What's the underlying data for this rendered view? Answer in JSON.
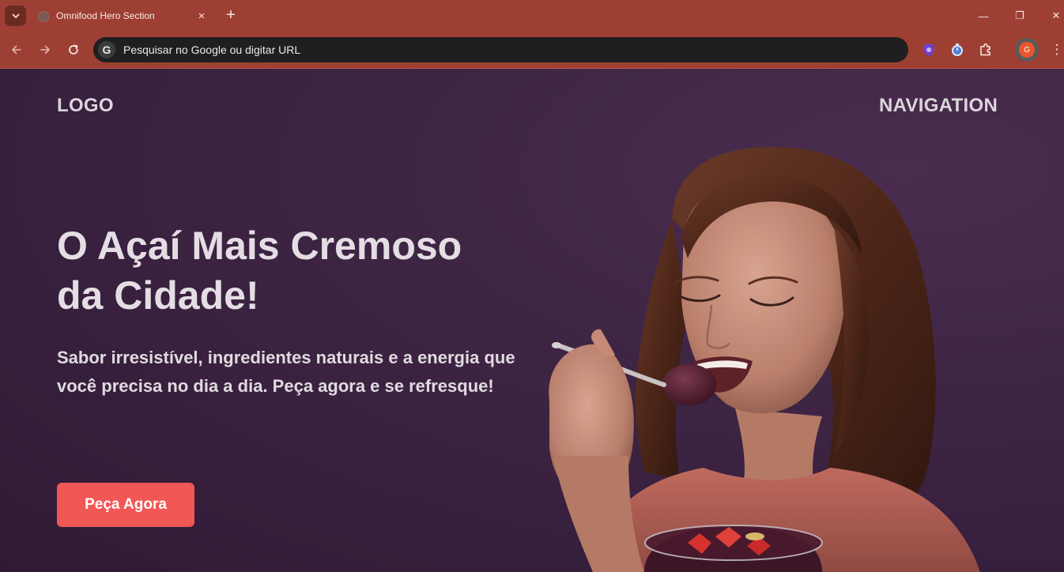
{
  "browser": {
    "tab_title": "Omnifood Hero Section",
    "tab_close": "×",
    "new_tab": "+",
    "omnibox_placeholder": "Pesquisar no Google ou digitar URL",
    "profile_initial": "G",
    "window": {
      "minimize": "—",
      "restore": "❐",
      "close": "✕"
    }
  },
  "hero": {
    "logo": "LOGO",
    "navigation": "NAVIGATION",
    "headline_line1": "O Açaí Mais Cremoso",
    "headline_line2": "da Cidade!",
    "subtext": "Sabor irresistível, ingredientes naturais e a energia que você precisa no dia a dia. Peça agora e se refresque!",
    "cta_label": "Peça Agora"
  },
  "colors": {
    "browser_frame": "#9e3f33",
    "hero_background": "#3d2443",
    "cta": "#f15754",
    "text": "#e4dee4"
  }
}
